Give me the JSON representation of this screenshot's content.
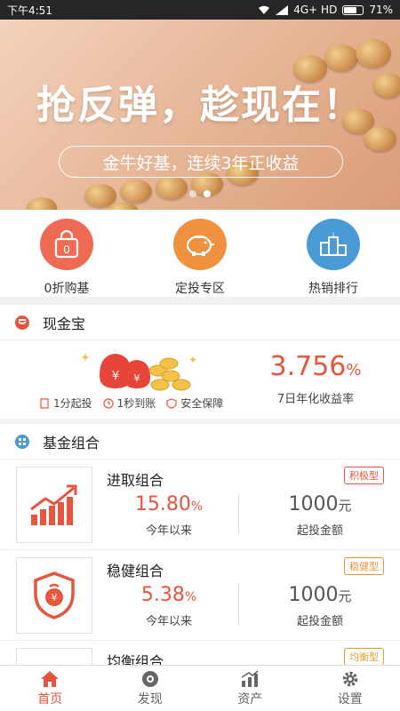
{
  "status_bar": {
    "time": "下午4:51",
    "network": "4G+ HD",
    "battery": "71%",
    "battery_level": 0.71
  },
  "banner": {
    "title": "抢反弹，趁现在！",
    "subtitle": "金牛好基，连续3年正收益",
    "slide_count": 2,
    "active_slide": 1
  },
  "quick_menu": [
    {
      "label": "0折购基",
      "icon": "shopping-bag-icon",
      "color": "#ef6a52"
    },
    {
      "label": "定投专区",
      "icon": "piggy-bank-icon",
      "color": "#f0913f"
    },
    {
      "label": "热销排行",
      "icon": "podium-icon",
      "color": "#4a9ad6"
    }
  ],
  "cash_section": {
    "title": "现金宝",
    "features": [
      "1分起投",
      "1秒到账",
      "安全保障"
    ],
    "rate": "3.756",
    "rate_unit": "%",
    "rate_label": "7日年化收益率"
  },
  "fund_section": {
    "title": "基金组合",
    "items": [
      {
        "name": "进取组合",
        "tag": "积极型",
        "tag_color": "#e8553e",
        "return": "15.80",
        "return_unit": "%",
        "return_label": "今年以来",
        "min": "1000",
        "min_unit": "元",
        "min_label": "起投金额",
        "icon": "trending-up-chart-icon"
      },
      {
        "name": "稳健组合",
        "tag": "稳健型",
        "tag_color": "#f0913f",
        "return": "5.38",
        "return_unit": "%",
        "return_label": "今年以来",
        "min": "1000",
        "min_unit": "元",
        "min_label": "起投金额",
        "icon": "shield-money-icon"
      },
      {
        "name": "均衡组合",
        "tag": "均衡型",
        "tag_color": "#e0a030",
        "icon": "balance-icon"
      }
    ]
  },
  "bottom_nav": [
    {
      "label": "首页",
      "icon": "home-icon",
      "active": true
    },
    {
      "label": "发现",
      "icon": "discover-icon",
      "active": false
    },
    {
      "label": "资产",
      "icon": "assets-chart-icon",
      "active": false
    },
    {
      "label": "设置",
      "icon": "gear-icon",
      "active": false
    }
  ],
  "colors": {
    "accent": "#e8553e",
    "orange": "#f0913f",
    "blue": "#4a9ad6"
  }
}
